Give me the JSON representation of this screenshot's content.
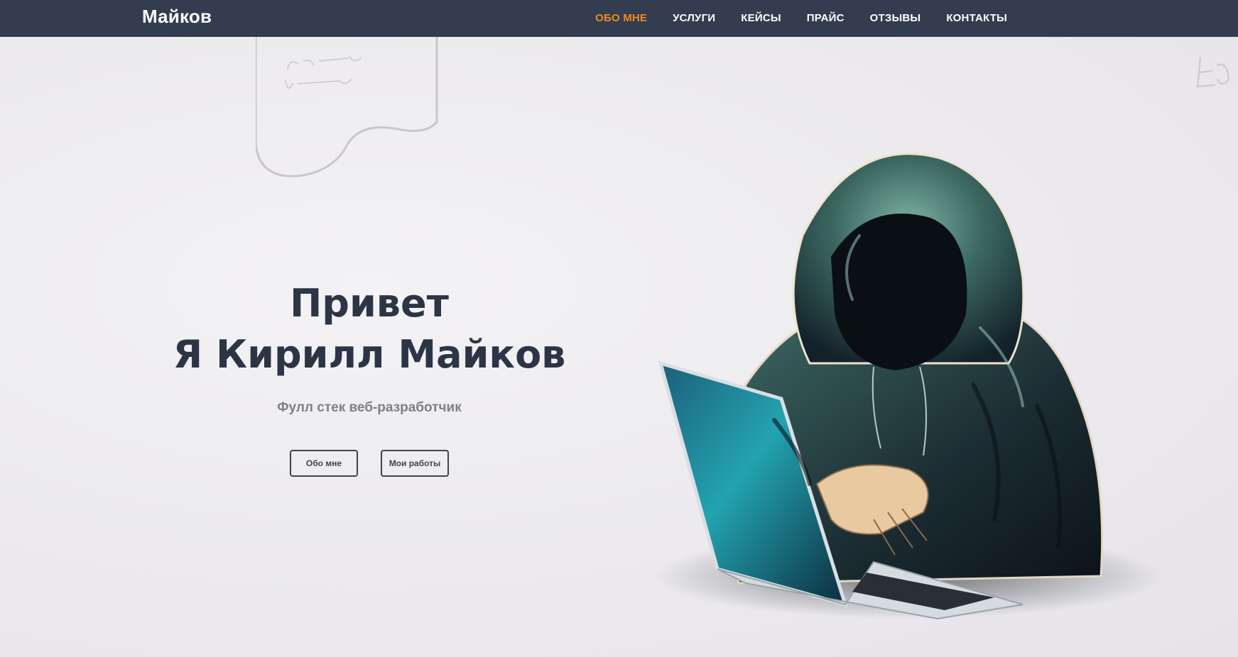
{
  "header": {
    "brand": "Майков",
    "nav": [
      {
        "label": "ОБО МНЕ",
        "active": true
      },
      {
        "label": "УСЛУГИ",
        "active": false
      },
      {
        "label": "КЕЙСЫ",
        "active": false
      },
      {
        "label": "ПРАЙС",
        "active": false
      },
      {
        "label": "ОТЗЫВЫ",
        "active": false
      },
      {
        "label": "КОНТАКТЫ",
        "active": false
      }
    ]
  },
  "hero": {
    "title_line1": "Привет",
    "title_line2": "Я Кирилл Майков",
    "subtitle": "Фулл стек веб-разработчик",
    "buttons": {
      "about": "Обо мне",
      "works": "Мои работы"
    }
  },
  "colors": {
    "navbar_bg": "#333d4f",
    "accent": "#f28a1c",
    "title": "#2c3546",
    "subtitle": "#7d808a"
  }
}
